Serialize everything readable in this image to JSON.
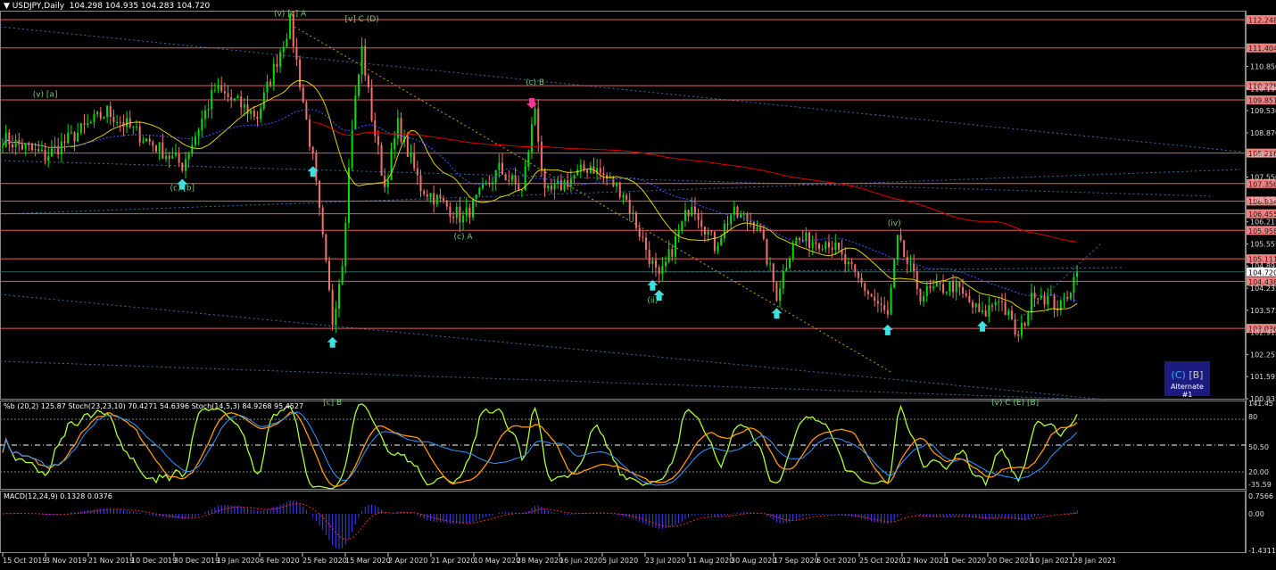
{
  "header": {
    "symbol_label": "USDJPY,Daily",
    "ohlc": "104.298 104.935 104.283 104.720"
  },
  "indicators": {
    "osc_label": "%b (20,2) 125.87  Stoch(23,23,10) 70.4271 54.6396  Stoch(14,5,3) 84.9268 95.4527",
    "macd_label": "MACD(12,24,9) 0.1328 0.0376",
    "osc_ticks": [
      "141.45",
      "80",
      "50.50",
      "20.00",
      "-35.59"
    ],
    "macd_ticks": [
      "0.7566",
      "0.00",
      "-1.4311"
    ]
  },
  "alternate": {
    "wave": "(C)",
    "bracket": "[B]",
    "label": "Alternate #1"
  },
  "colors": {
    "up": "#00e000",
    "down": "#f07070",
    "level": "#e06060",
    "label_bg": "#f08080",
    "ma_fast": "#e0d000",
    "ma_mid": "#3a5cff",
    "ma_slow": "#e00000",
    "stoch_fast": "#adff2f",
    "stoch_slow": "#ff9900",
    "pb": "#3399ff",
    "macd": "#4040ff"
  },
  "chart_data": {
    "type": "candlestick",
    "title": "USDJPY,Daily",
    "current_price": "104.720",
    "ylim": [
      100.935,
      112.248
    ],
    "y_ticks": [
      "110.850",
      "110.190",
      "109.530",
      "108.870",
      "108.210",
      "107.550",
      "106.890",
      "106.215",
      "105.555",
      "104.895",
      "104.235",
      "103.575",
      "102.915",
      "102.255",
      "101.595",
      "100.935"
    ],
    "levels": [
      "112.248",
      "111.404",
      "110.278",
      "109.851",
      "108.266",
      "107.356",
      "106.834",
      "106.455",
      "105.958",
      "105.111",
      "104.438",
      "103.036"
    ],
    "x_ticks": [
      "15 Oct 2019",
      "3 Nov 2019",
      "21 Nov 2019",
      "10 Dec 2019",
      "30 Dec 2019",
      "19 Jan 2020",
      "6 Feb 2020",
      "25 Feb 2020",
      "15 Mar 2020",
      "2 Apr 2020",
      "21 Apr 2020",
      "10 May 2020",
      "28 May 2020",
      "16 Jun 2020",
      "5 Jul 2020",
      "23 Jul 2020",
      "11 Aug 2020",
      "30 Aug 2020",
      "17 Sep 2020",
      "6 Oct 2020",
      "25 Oct 2020",
      "12 Nov 2020",
      "1 Dec 2020",
      "20 Dec 2020",
      "10 Jan 2021",
      "28 Jan 2021"
    ],
    "bars": 330,
    "price_path": [
      [
        0,
        108.71
      ],
      [
        13,
        108.17
      ],
      [
        32,
        109.5
      ],
      [
        55,
        107.9
      ],
      [
        65,
        110.17
      ],
      [
        78,
        109.37
      ],
      [
        88,
        112.17
      ],
      [
        95,
        108.04
      ],
      [
        101,
        103.25
      ],
      [
        104,
        105.1
      ],
      [
        107,
        109.1
      ],
      [
        110,
        111.37
      ],
      [
        113,
        109.37
      ],
      [
        117,
        107.25
      ],
      [
        121,
        109.1
      ],
      [
        128,
        107.25
      ],
      [
        141,
        106.31
      ],
      [
        152,
        107.78
      ],
      [
        159,
        107.11
      ],
      [
        163,
        109.64
      ],
      [
        166,
        106.98
      ],
      [
        180,
        107.9
      ],
      [
        190,
        107.1
      ],
      [
        201,
        104.45
      ],
      [
        211,
        106.85
      ],
      [
        218,
        105.5
      ],
      [
        223,
        106.45
      ],
      [
        231,
        106.18
      ],
      [
        237,
        104.05
      ],
      [
        242,
        105.65
      ],
      [
        253,
        105.65
      ],
      [
        261,
        104.58
      ],
      [
        271,
        103.38
      ],
      [
        274,
        105.65
      ],
      [
        281,
        104.05
      ],
      [
        291,
        104.32
      ],
      [
        300,
        103.38
      ],
      [
        305,
        104.0
      ],
      [
        311,
        102.72
      ],
      [
        316,
        104.18
      ],
      [
        324,
        103.65
      ],
      [
        329,
        104.72
      ]
    ],
    "annotations": [
      {
        "bar": 88,
        "price": 112.35,
        "text": "(v) [c] A"
      },
      {
        "bar": 110,
        "price": 112.2,
        "text": "[v] C (D)"
      },
      {
        "bar": 163,
        "price": 110.3,
        "text": "(c) B"
      },
      {
        "bar": 101,
        "price": 100.75,
        "text": "[c] B"
      },
      {
        "bar": 141,
        "price": 105.7,
        "text": "(c) A"
      },
      {
        "bar": 55,
        "price": 107.15,
        "text": "(c) [b]"
      },
      {
        "bar": 13,
        "price": 109.95,
        "text": "(v) [a]"
      },
      {
        "bar": 273,
        "price": 106.1,
        "text": "(iv)"
      },
      {
        "bar": 199,
        "price": 103.8,
        "text": "(ii)"
      },
      {
        "bar": 310,
        "price": 100.75,
        "text": "(v) C (E) [B]"
      }
    ],
    "up_arrows": [
      55,
      95,
      101,
      199,
      201,
      237,
      271,
      300
    ],
    "down_arrows": [
      162
    ]
  }
}
